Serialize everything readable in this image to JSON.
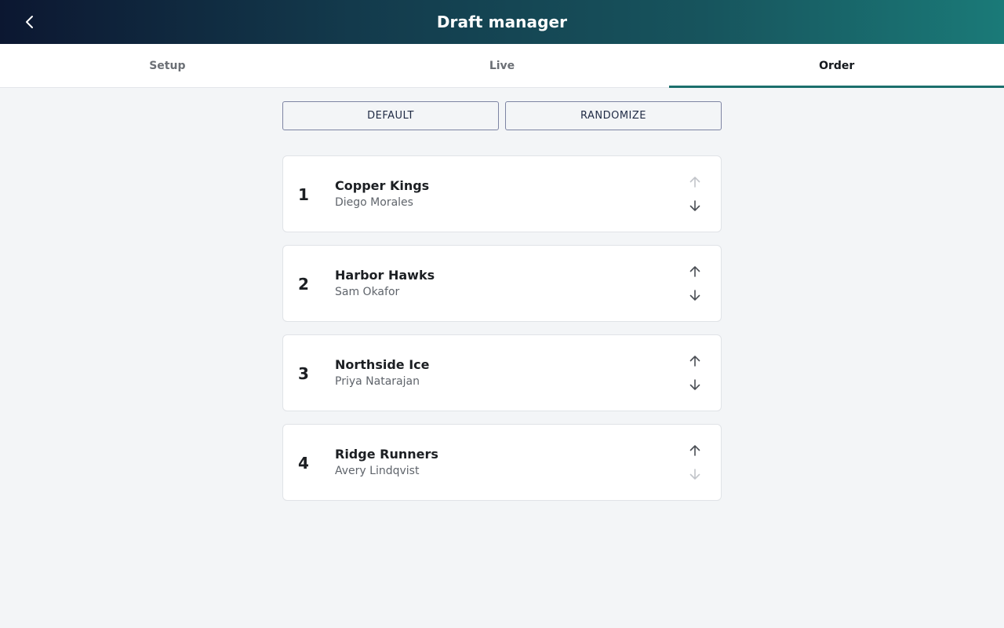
{
  "header": {
    "title": "Draft manager",
    "back_icon": "chevron-left-icon"
  },
  "tabs": [
    {
      "label": "Setup",
      "active": false
    },
    {
      "label": "Live",
      "active": false
    },
    {
      "label": "Order",
      "active": true
    }
  ],
  "actions": {
    "default_label": "DEFAULT",
    "randomize_label": "RANDOMIZE"
  },
  "draft_order": [
    {
      "position": "1",
      "team": "Copper Kings",
      "owner": "Diego Morales",
      "up_enabled": false,
      "down_enabled": true
    },
    {
      "position": "2",
      "team": "Harbor Hawks",
      "owner": "Sam Okafor",
      "up_enabled": true,
      "down_enabled": true
    },
    {
      "position": "3",
      "team": "Northside Ice",
      "owner": "Priya Natarajan",
      "up_enabled": true,
      "down_enabled": true
    },
    {
      "position": "4",
      "team": "Ridge Runners",
      "owner": "Avery Lindqvist",
      "up_enabled": true,
      "down_enabled": false
    }
  ],
  "colors": {
    "accent": "#1b6f6c",
    "header_gradient_start": "#0c1731",
    "header_gradient_end": "#1a7a78",
    "button_border": "#7d84a3"
  }
}
